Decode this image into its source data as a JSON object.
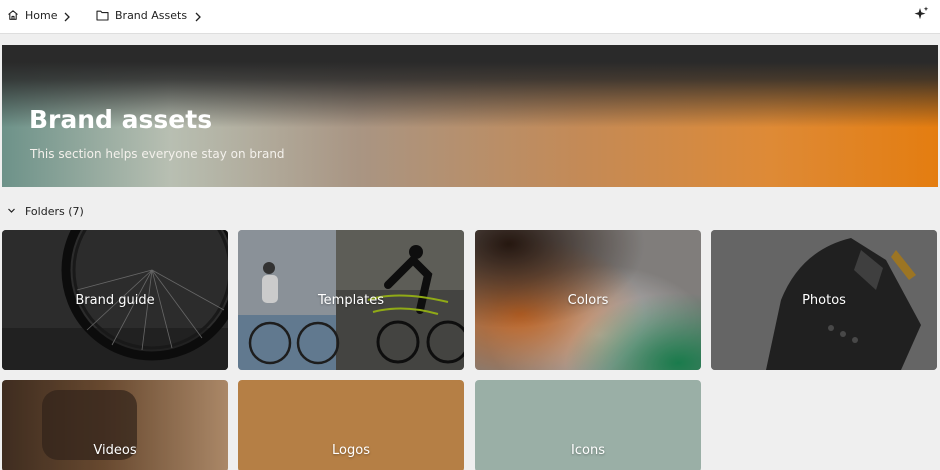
{
  "breadcrumb": {
    "home_label": "Home",
    "folder_label": "Brand Assets"
  },
  "banner": {
    "title": "Brand assets",
    "subtitle": "This section helps everyone stay on brand"
  },
  "folders_section": {
    "label": "Folders (7)"
  },
  "folders": [
    {
      "name": "Brand guide",
      "thumbnail": "bicycle wheel photo"
    },
    {
      "name": "Templates",
      "thumbnail": "cyclist photo collage"
    },
    {
      "name": "Colors",
      "thumbnail": "color gradient"
    },
    {
      "name": "Photos",
      "thumbnail": "bike part photo"
    },
    {
      "name": "Videos",
      "thumbnail": "blurred photo"
    },
    {
      "name": "Logos",
      "thumbnail": "solid #b57f45"
    },
    {
      "name": "Icons",
      "thumbnail": "solid #9aafa6"
    }
  ],
  "colors": {
    "logos_card": "#b57f45",
    "icons_card": "#9aafa6",
    "banner_accent": "#e47d10"
  }
}
